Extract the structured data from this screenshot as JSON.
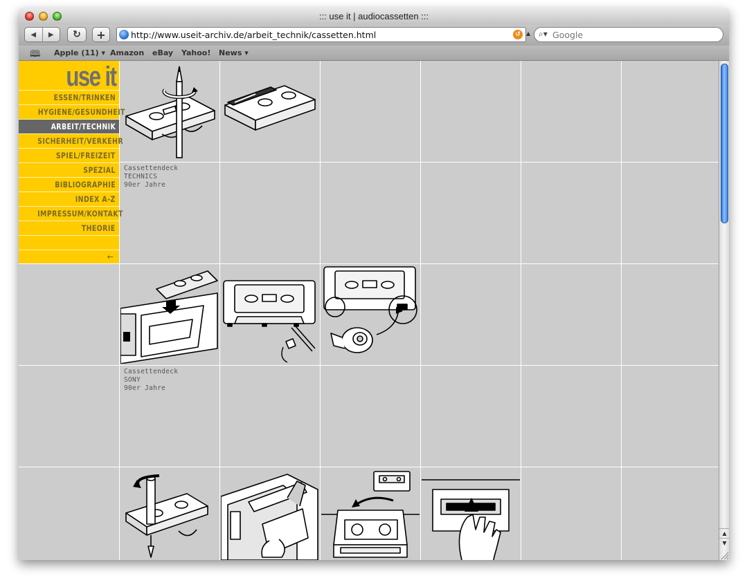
{
  "window": {
    "title": "::: use it | audiocassetten :::"
  },
  "toolbar": {
    "back_label": "◀",
    "forward_label": "▶",
    "reload_label": "↻",
    "add_label": "+",
    "url": "http://www.useit-archiv.de/arbeit_technik/cassetten.html",
    "search_placeholder": "Google"
  },
  "bookmarks": {
    "items": [
      {
        "label": "Apple (11) ▾"
      },
      {
        "label": "Amazon"
      },
      {
        "label": "eBay"
      },
      {
        "label": "Yahoo!"
      },
      {
        "label": "News ▾"
      }
    ]
  },
  "sidebar": {
    "logo": "use it",
    "items": [
      {
        "label": "ESSEN/TRINKEN",
        "active": false
      },
      {
        "label": "HYGIENE/GESUNDHEIT",
        "active": false
      },
      {
        "label": "ARBEIT/TECHNIK",
        "active": true
      },
      {
        "label": "SICHERHEIT/VERKEHR",
        "active": false
      },
      {
        "label": "SPIEL/FREIZEIT",
        "active": false
      },
      {
        "label": "SPEZIAL",
        "active": false
      },
      {
        "label": "BIBLIOGRAPHIE",
        "active": false
      },
      {
        "label": "INDEX A-Z",
        "active": false
      },
      {
        "label": "IMPRESSUM/KONTAKT",
        "active": false
      },
      {
        "label": "THEORIE",
        "active": false
      }
    ],
    "back_arrow": "←"
  },
  "captions": [
    {
      "line1": "Cassettendeck",
      "line2": "TECHNICS",
      "line3": "90er Jahre"
    },
    {
      "line1": "Cassettendeck",
      "line2": "SONY",
      "line3": "90er Jahre"
    }
  ],
  "illustrations": [
    {
      "icon": "cassette-pencil-winding-icon",
      "row": 1,
      "col": 1
    },
    {
      "icon": "cassette-tape-splicing-icon",
      "row": 1,
      "col": 2
    },
    {
      "icon": "cassette-deck-loading-icon",
      "row": 3,
      "col": 1
    },
    {
      "icon": "cassette-tab-break-icon",
      "row": 3,
      "col": 2
    },
    {
      "icon": "cassette-tab-tape-cover-icon",
      "row": 3,
      "col": 3
    },
    {
      "icon": "cassette-pencil-rewind-icon",
      "row": 5,
      "col": 1
    },
    {
      "icon": "cassette-deck-insert-hand-icon",
      "row": 5,
      "col": 2
    },
    {
      "icon": "cassette-flip-insert-icon",
      "row": 5,
      "col": 3
    },
    {
      "icon": "cassette-slot-push-icon",
      "row": 5,
      "col": 4
    }
  ]
}
